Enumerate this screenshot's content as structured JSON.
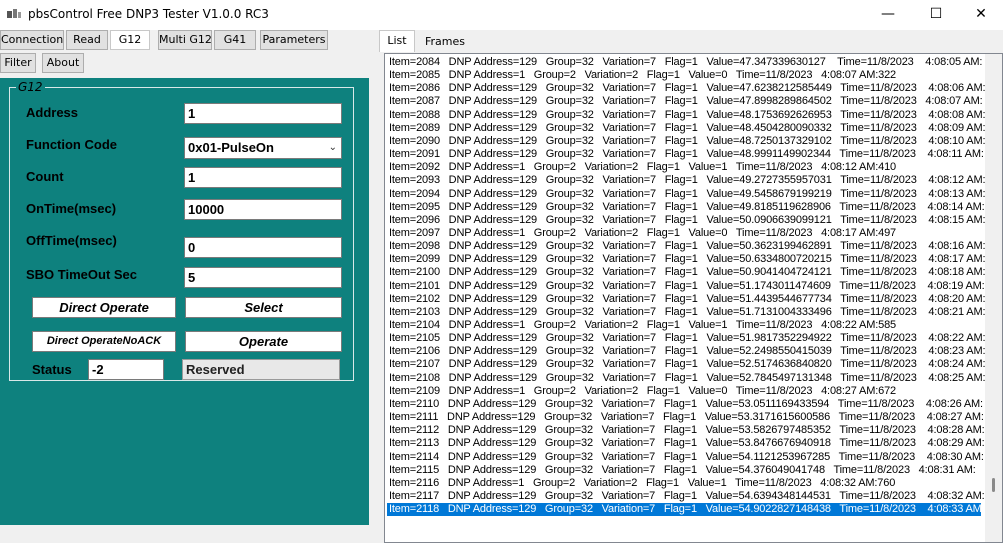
{
  "window": {
    "title": "pbsControl Free DNP3 Tester   V1.0.0 RC3",
    "minimize_glyph": "—",
    "maximize_glyph": "☐",
    "close_glyph": "✕",
    "icon": "app-logo-icon"
  },
  "toolbar": {
    "row1": [
      "Connection",
      "Read",
      "G12",
      "Multi G12",
      "G41",
      "Parameters"
    ],
    "row2": [
      "Filter",
      "About"
    ],
    "active": "G12"
  },
  "g12": {
    "group_title": "G12",
    "address_label": "Address",
    "address_value": "1",
    "function_code_label": "Function Code",
    "function_code_value": "0x01-PulseOn",
    "count_label": "Count",
    "count_value": "1",
    "ontime_label": "OnTime(msec)",
    "ontime_value": "10000",
    "offtime_label": "OffTime(msec)",
    "offtime_value": "0",
    "sbo_label": "SBO TimeOut Sec",
    "sbo_value": "5",
    "direct_operate_label": "Direct  Operate",
    "select_label": "Select",
    "direct_operate_noack_label": "Direct  OperateNoACK",
    "operate_label": "Operate",
    "status_label": "Status",
    "status_value": "-2",
    "status_text": "Reserved"
  },
  "tabs": {
    "list_label": "List",
    "frames_label": "Frames"
  },
  "list": {
    "selected_index": 34,
    "rows": [
      "Item=2084   DNP Address=129   Group=32   Variation=7   Flag=1   Value=47.347339630127    Time=11/8/2023    4:08:05 AM:",
      "Item=2085   DNP Address=1   Group=2   Variation=2   Flag=1   Value=0   Time=11/8/2023   4:08:07 AM:322",
      "Item=2086   DNP Address=129   Group=32   Variation=7   Flag=1   Value=47.6238212585449   Time=11/8/2023    4:08:06 AM:",
      "Item=2087   DNP Address=129   Group=32   Variation=7   Flag=1   Value=47.8998289864502   Time=11/8/2023   4:08:07 AM:",
      "Item=2088   DNP Address=129   Group=32   Variation=7   Flag=1   Value=48.1753692626953   Time=11/8/2023    4:08:08 AM:",
      "Item=2089   DNP Address=129   Group=32   Variation=7   Flag=1   Value=48.4504280090332   Time=11/8/2023    4:08:09 AM:",
      "Item=2090   DNP Address=129   Group=32   Variation=7   Flag=1   Value=48.7250137329102   Time=11/8/2023    4:08:10 AM:",
      "Item=2091   DNP Address=129   Group=32   Variation=7   Flag=1   Value=48.9991149902344   Time=11/8/2023    4:08:11 AM:",
      "Item=2092   DNP Address=1   Group=2   Variation=2   Flag=1   Value=1   Time=11/8/2023   4:08:12 AM:410",
      "Item=2093   DNP Address=129   Group=32   Variation=7   Flag=1   Value=49.2727355957031   Time=11/8/2023    4:08:12 AM:",
      "Item=2094   DNP Address=129   Group=32   Variation=7   Flag=1   Value=49.5458679199219   Time=11/8/2023    4:08:13 AM:",
      "Item=2095   DNP Address=129   Group=32   Variation=7   Flag=1   Value=49.8185119628906   Time=11/8/2023    4:08:14 AM:",
      "Item=2096   DNP Address=129   Group=32   Variation=7   Flag=1   Value=50.0906639099121   Time=11/8/2023    4:08:15 AM:",
      "Item=2097   DNP Address=1   Group=2   Variation=2   Flag=1   Value=0   Time=11/8/2023   4:08:17 AM:497",
      "Item=2098   DNP Address=129   Group=32   Variation=7   Flag=1   Value=50.3623199462891   Time=11/8/2023    4:08:16 AM:",
      "Item=2099   DNP Address=129   Group=32   Variation=7   Flag=1   Value=50.6334800720215   Time=11/8/2023    4:08:17 AM:",
      "Item=2100   DNP Address=129   Group=32   Variation=7   Flag=1   Value=50.9041404724121   Time=11/8/2023    4:08:18 AM:",
      "Item=2101   DNP Address=129   Group=32   Variation=7   Flag=1   Value=51.1743011474609   Time=11/8/2023    4:08:19 AM:",
      "Item=2102   DNP Address=129   Group=32   Variation=7   Flag=1   Value=51.4439544677734   Time=11/8/2023    4:08:20 AM:",
      "Item=2103   DNP Address=129   Group=32   Variation=7   Flag=1   Value=51.7131004333496   Time=11/8/2023    4:08:21 AM:",
      "Item=2104   DNP Address=1   Group=2   Variation=2   Flag=1   Value=1   Time=11/8/2023   4:08:22 AM:585",
      "Item=2105   DNP Address=129   Group=32   Variation=7   Flag=1   Value=51.9817352294922   Time=11/8/2023    4:08:22 AM:",
      "Item=2106   DNP Address=129   Group=32   Variation=7   Flag=1   Value=52.2498550415039   Time=11/8/2023    4:08:23 AM:",
      "Item=2107   DNP Address=129   Group=32   Variation=7   Flag=1   Value=52.5174636840820   Time=11/8/2023    4:08:24 AM:",
      "Item=2108   DNP Address=129   Group=32   Variation=7   Flag=1   Value=52.7845497131348   Time=11/8/2023    4:08:25 AM:",
      "Item=2109   DNP Address=1   Group=2   Variation=2   Flag=1   Value=0   Time=11/8/2023   4:08:27 AM:672",
      "Item=2110   DNP Address=129   Group=32   Variation=7   Flag=1   Value=53.0511169433594   Time=11/8/2023    4:08:26 AM:",
      "Item=2111   DNP Address=129   Group=32   Variation=7   Flag=1   Value=53.3171615600586   Time=11/8/2023    4:08:27 AM:",
      "Item=2112   DNP Address=129   Group=32   Variation=7   Flag=1   Value=53.5826797485352   Time=11/8/2023    4:08:28 AM:",
      "Item=2113   DNP Address=129   Group=32   Variation=7   Flag=1   Value=53.8476676940918   Time=11/8/2023    4:08:29 AM:",
      "Item=2114   DNP Address=129   Group=32   Variation=7   Flag=1   Value=54.1121253967285   Time=11/8/2023    4:08:30 AM:",
      "Item=2115   DNP Address=129   Group=32   Variation=7   Flag=1   Value=54.376049041748   Time=11/8/2023   4:08:31 AM:",
      "Item=2116   DNP Address=1   Group=2   Variation=2   Flag=1   Value=1   Time=11/8/2023   4:08:32 AM:760",
      "Item=2117   DNP Address=129   Group=32   Variation=7   Flag=1   Value=54.6394348144531   Time=11/8/2023    4:08:32 AM:",
      "Item=2118   DNP Address=129   Group=32   Variation=7   Flag=1   Value=54.9022827148438   Time=11/8/2023    4:08:33 AM:"
    ]
  },
  "colors": {
    "panel_teal": "#0e817e",
    "selection_blue": "#0078d7"
  }
}
